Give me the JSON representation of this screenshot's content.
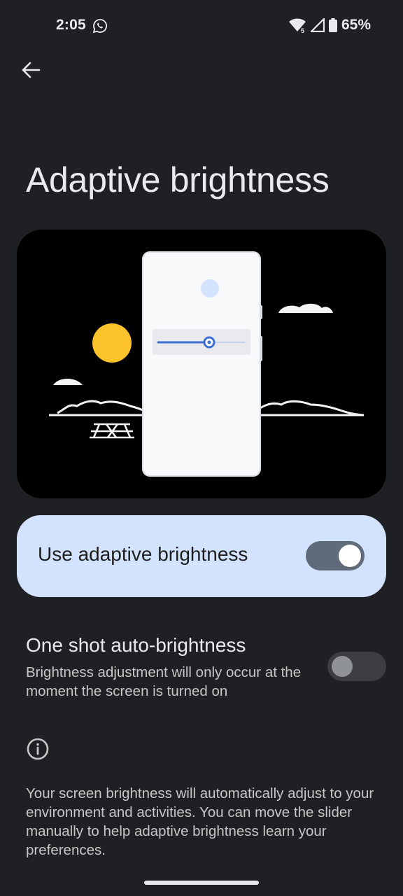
{
  "status_bar": {
    "time": "2:05",
    "battery": "65%",
    "network_badge": "5",
    "icons": [
      "whatsapp-icon",
      "wifi-icon",
      "cellular-signal-icon",
      "battery-icon"
    ]
  },
  "header": {
    "back_icon": "arrow-left-icon"
  },
  "page": {
    "title": "Adaptive brightness"
  },
  "adaptive_setting": {
    "label": "Use adaptive brightness",
    "enabled": true
  },
  "one_shot_setting": {
    "title": "One shot auto-brightness",
    "description": "Brightness adjustment will only occur at the moment the screen is turned on",
    "enabled": false
  },
  "footer": {
    "info_icon": "info-icon",
    "text": "Your screen brightness will automatically adjust to your environment and activities. You can move the slider manually to help adaptive brightness learn your preferences."
  },
  "colors": {
    "background": "#1f2023",
    "card_active": "#d3e3fd",
    "sun": "#fdc32d",
    "slider_accent": "#3b6fd4"
  }
}
